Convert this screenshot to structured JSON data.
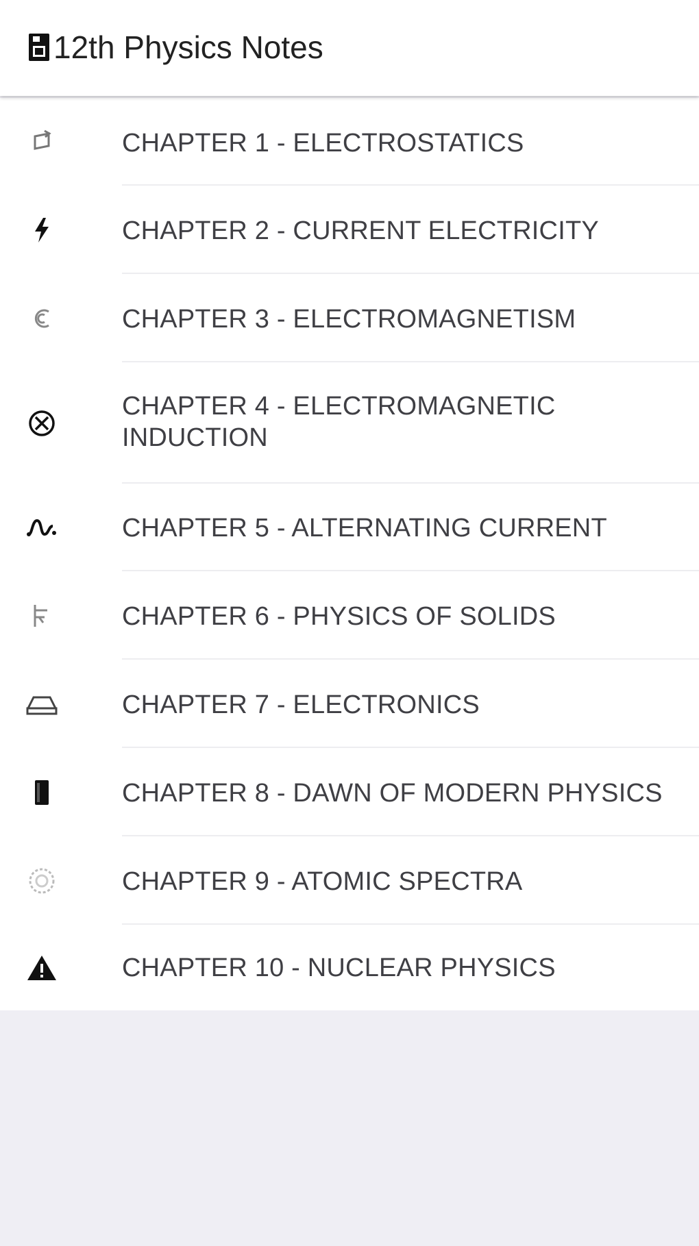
{
  "header": {
    "title": "12th Physics Notes",
    "icon": "document-icon"
  },
  "chapters": [
    {
      "label": "CHAPTER 1 - ELECTROSTATICS",
      "icon": "refresh-icon"
    },
    {
      "label": "CHAPTER 2 - CURRENT ELECTRICITY",
      "icon": "lightning-icon"
    },
    {
      "label": "CHAPTER 3 - ELECTROMAGNETISM",
      "icon": "magnet-icon"
    },
    {
      "label": "CHAPTER 4 - ELECTROMAGNETIC INDUCTION",
      "icon": "coil-icon"
    },
    {
      "label": "CHAPTER 5 - ALTERNATING CURRENT",
      "icon": "sine-wave-icon"
    },
    {
      "label": "CHAPTER 6 - PHYSICS OF SOLIDS",
      "icon": "spring-icon"
    },
    {
      "label": "CHAPTER 7 - ELECTRONICS",
      "icon": "chip-icon"
    },
    {
      "label": "CHAPTER 8 - DAWN OF MODERN PHYSICS",
      "icon": "lightbulb-icon"
    },
    {
      "label": "CHAPTER 9 - ATOMIC SPECTRA",
      "icon": "atom-icon"
    },
    {
      "label": "CHAPTER 10 - NUCLEAR PHYSICS",
      "icon": "radiation-warning-icon"
    }
  ],
  "colors": {
    "background": "#efeef4",
    "surface": "#ffffff",
    "text": "#3f3f44",
    "title": "#222222",
    "divider": "#ededf0"
  }
}
